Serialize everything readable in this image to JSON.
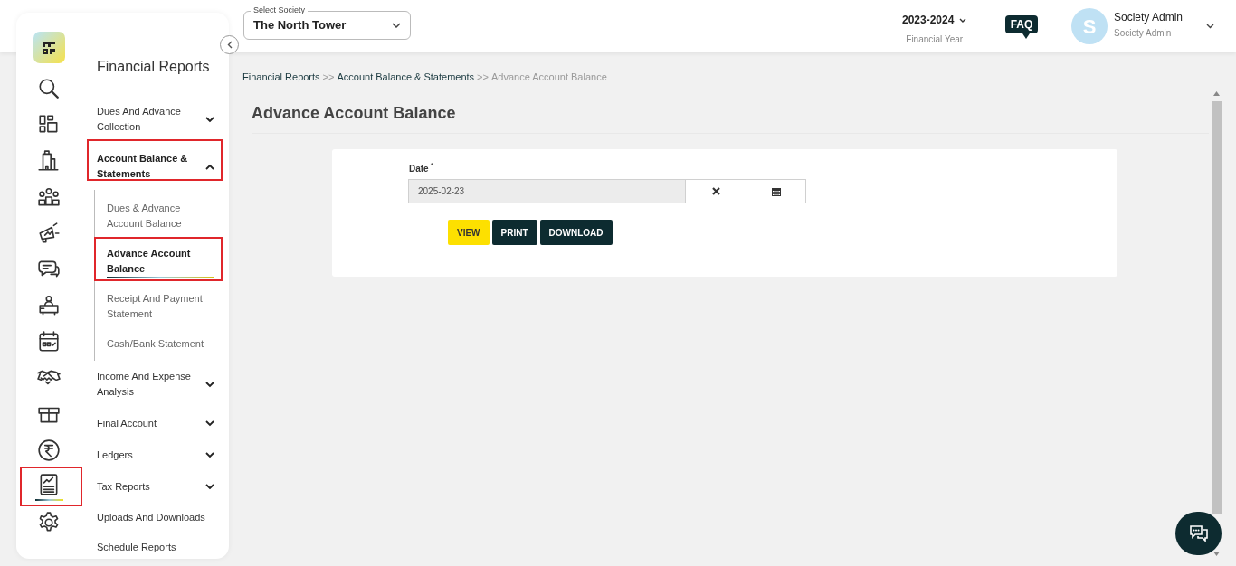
{
  "society_select": {
    "label": "Select Society",
    "value": "The North Tower"
  },
  "financial_year": {
    "value": "2023-2024",
    "label": "Financial Year"
  },
  "faq": "FAQ",
  "user": {
    "avatar_letter": "S",
    "name": "Society Admin",
    "role": "Society Admin"
  },
  "rail_icons": [
    {
      "kind": "search",
      "selected": false,
      "highlighted": false
    },
    {
      "kind": "dashboard",
      "selected": false,
      "highlighted": false
    },
    {
      "kind": "building",
      "selected": false,
      "highlighted": false
    },
    {
      "kind": "people",
      "selected": false,
      "highlighted": false
    },
    {
      "kind": "megaphone",
      "selected": false,
      "highlighted": false
    },
    {
      "kind": "chat",
      "selected": false,
      "highlighted": false
    },
    {
      "kind": "desk",
      "selected": false,
      "highlighted": false
    },
    {
      "kind": "calendar",
      "selected": false,
      "highlighted": false
    },
    {
      "kind": "handshake",
      "selected": false,
      "highlighted": false
    },
    {
      "kind": "box",
      "selected": false,
      "highlighted": false
    },
    {
      "kind": "rupee",
      "selected": false,
      "highlighted": false
    },
    {
      "kind": "report",
      "selected": true,
      "highlighted": true
    },
    {
      "kind": "settings",
      "selected": false,
      "highlighted": false
    }
  ],
  "menu": {
    "title": "Financial Reports",
    "items": [
      {
        "label": "Dues And Advance Collection",
        "kind": "group",
        "expanded": false,
        "highlighted": false
      },
      {
        "label": "Account Balance & Statements",
        "kind": "group",
        "expanded": true,
        "highlighted": true,
        "children": [
          {
            "label": "Dues & Advance Account Balance",
            "selected": false,
            "highlighted": false
          },
          {
            "label": "Advance Account Balance",
            "selected": true,
            "highlighted": true
          },
          {
            "label": "Receipt And Payment Statement",
            "selected": false,
            "highlighted": false
          },
          {
            "label": "Cash/Bank Statement",
            "selected": false,
            "highlighted": false
          }
        ]
      },
      {
        "label": "Income And Expense Analysis",
        "kind": "group",
        "expanded": false,
        "highlighted": false
      },
      {
        "label": "Final Account",
        "kind": "group",
        "expanded": false,
        "highlighted": false
      },
      {
        "label": "Ledgers",
        "kind": "group",
        "expanded": false,
        "highlighted": false
      },
      {
        "label": "Tax Reports",
        "kind": "group",
        "expanded": false,
        "highlighted": false
      },
      {
        "label": "Uploads And Downloads",
        "kind": "link",
        "highlighted": false
      },
      {
        "label": "Schedule Reports",
        "kind": "link",
        "highlighted": false
      }
    ]
  },
  "breadcrumb": [
    {
      "label": "Financial Reports",
      "current": false
    },
    {
      "separator": ">>"
    },
    {
      "label": "Account Balance & Statements",
      "current": false
    },
    {
      "separator": ">>"
    },
    {
      "label": "Advance Account Balance",
      "current": true
    }
  ],
  "page_title": "Advance Account Balance",
  "form": {
    "date_label": "Date",
    "required_mark": "*",
    "date_value": "2025-02-23",
    "buttons": [
      {
        "label": "VIEW",
        "kind": "primary"
      },
      {
        "label": "PRINT",
        "kind": "dark"
      },
      {
        "label": "DOWNLOAD",
        "kind": "dark"
      }
    ]
  }
}
